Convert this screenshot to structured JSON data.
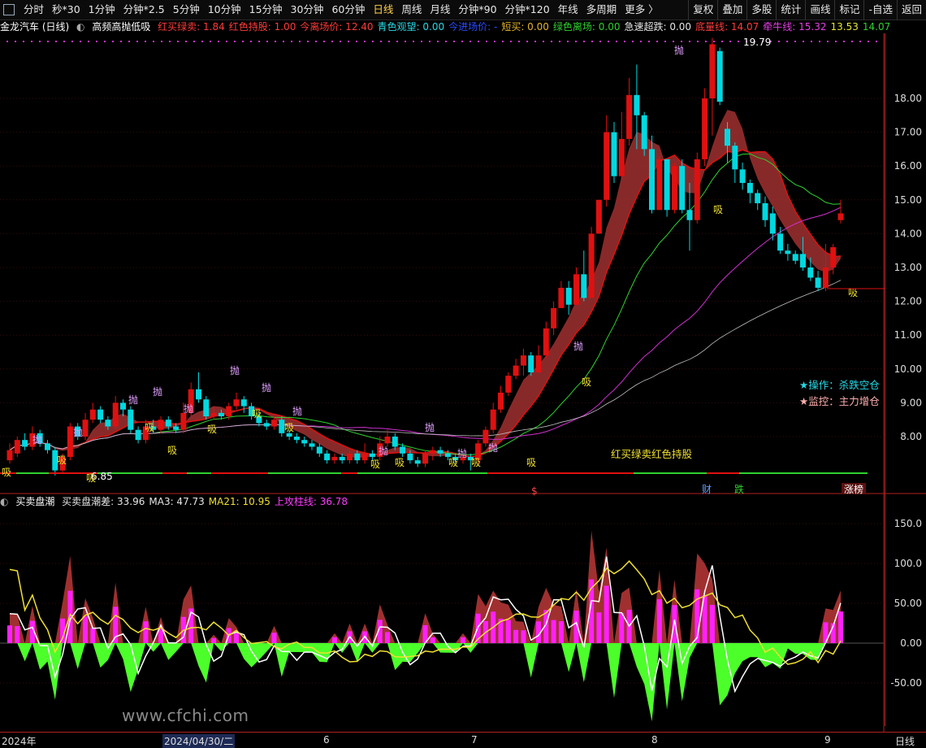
{
  "toolbar": {
    "periods": [
      "分时",
      "秒*30",
      "1分钟",
      "分钟*2.5",
      "5分钟",
      "10分钟",
      "15分钟",
      "30分钟",
      "60分钟",
      "日线",
      "周线",
      "月线",
      "分钟*90",
      "分钟*120",
      "年线",
      "多周期",
      "更多 〉"
    ],
    "active_period": "日线",
    "right_buttons": [
      "复权",
      "叠加",
      "多股",
      "统计",
      "画线",
      "标记",
      "-自选",
      "返回"
    ]
  },
  "stock": {
    "name": "金龙汽车 (日线)"
  },
  "main_indicator": {
    "name": "高频高抛低吸",
    "fields": [
      {
        "label": "红买绿卖:",
        "value": "1.84",
        "color": "#ff3b3b"
      },
      {
        "label": "红色持股:",
        "value": "1.00",
        "color": "#ff3b3b"
      },
      {
        "label": "今离场价:",
        "value": "12.40",
        "color": "#ff3b3b"
      },
      {
        "label": "青色观望:",
        "value": "0.00",
        "color": "#26d9e6"
      },
      {
        "label": "今进场价:",
        "value": "-",
        "color": "#2a4cff"
      },
      {
        "label": "短买:",
        "value": "0.00",
        "color": "#e5b62a"
      },
      {
        "label": "绿色离场:",
        "value": "0.00",
        "color": "#2ed12e"
      },
      {
        "label": "急速超跌:",
        "value": "0.00",
        "color": "#e6e6e6"
      },
      {
        "label": "底量线:",
        "value": "14.07",
        "color": "#ff3b3b"
      },
      {
        "label": "牵牛线:",
        "value": "15.32",
        "color": "#e63ee6"
      },
      {
        "label": "",
        "value": "13.53",
        "color": "#e6e62a"
      },
      {
        "label": "",
        "value": "14.07",
        "color": "#2ed12e"
      }
    ]
  },
  "sub_indicator": {
    "name": "买卖盘潮",
    "fields": [
      {
        "label": "买卖盘潮差:",
        "value": "33.96",
        "color": "#e6e6e6"
      },
      {
        "label": "MA3:",
        "value": "47.73",
        "color": "#e6e6e6"
      },
      {
        "label": "MA21:",
        "value": "10.95",
        "color": "#f0e030"
      },
      {
        "label": "上攻柱线:",
        "value": "36.78",
        "color": "#ff3bff"
      }
    ]
  },
  "price_axis": [
    "18.00",
    "17.00",
    "16.00",
    "15.00",
    "14.00",
    "13.00",
    "12.00",
    "11.00",
    "10.00",
    "9.00",
    "8.00"
  ],
  "sub_axis": [
    "150.0",
    "100.0",
    "50.00",
    "0.00",
    "-50.00"
  ],
  "date_axis": [
    "2024年",
    "2024/04/30/二",
    "6",
    "7",
    "8",
    "9",
    "日线"
  ],
  "annotations": {
    "high_label": "19.79",
    "low_label": "6.85",
    "op_label": "★操作：杀跌空仓",
    "monitor_label": "★监控：主力增仓",
    "legend_text": "红买绿卖红色持股",
    "sell_mark": "抛",
    "buy_mark": "吸",
    "events": [
      "$",
      "财",
      "跌",
      "涨榜"
    ]
  },
  "colors": {
    "up": "#e01010",
    "down": "#00d8e0",
    "ma_white": "#ffffff",
    "ma_yellow": "#f0e030",
    "ma_green": "#2ed12e",
    "ma_magenta": "#d030d0",
    "ribbon_red": "#a03030",
    "ribbon_green": "#78a040"
  },
  "watermark": "www.cfchi.com",
  "chart_data": {
    "type": "candlestick",
    "title": "金龙汽车 (日线)",
    "ylim": [
      7.0,
      19.8
    ],
    "candles": [
      [
        7.3,
        7.6,
        7.8,
        7.2
      ],
      [
        7.5,
        7.9,
        8.0,
        7.4
      ],
      [
        7.9,
        7.7,
        8.1,
        7.6
      ],
      [
        7.7,
        8.1,
        8.3,
        7.6
      ],
      [
        8.1,
        7.8,
        8.2,
        7.7
      ],
      [
        7.8,
        7.6,
        7.9,
        7.5
      ],
      [
        7.6,
        7.0,
        7.7,
        6.85
      ],
      [
        7.0,
        7.4,
        7.5,
        6.9
      ],
      [
        7.4,
        8.3,
        8.4,
        7.3
      ],
      [
        8.3,
        8.0,
        8.4,
        7.9
      ],
      [
        8.0,
        8.5,
        8.7,
        7.9
      ],
      [
        8.5,
        8.8,
        9.0,
        8.4
      ],
      [
        8.8,
        8.5,
        8.9,
        8.4
      ],
      [
        8.5,
        8.3,
        8.6,
        8.2
      ],
      [
        8.3,
        9.0,
        9.2,
        8.2
      ],
      [
        9.0,
        8.8,
        9.1,
        8.6
      ],
      [
        8.8,
        8.2,
        8.9,
        8.1
      ],
      [
        8.2,
        7.9,
        8.3,
        7.8
      ],
      [
        7.9,
        8.3,
        8.5,
        7.8
      ],
      [
        8.3,
        8.2,
        8.5,
        8.1
      ],
      [
        8.2,
        8.5,
        8.6,
        8.1
      ],
      [
        8.5,
        8.3,
        8.6,
        8.2
      ],
      [
        8.3,
        8.2,
        8.4,
        8.1
      ],
      [
        8.2,
        8.7,
        9.0,
        8.1
      ],
      [
        8.7,
        9.4,
        9.6,
        8.6
      ],
      [
        9.4,
        9.1,
        9.9,
        9.0
      ],
      [
        9.1,
        8.6,
        9.2,
        8.5
      ],
      [
        8.6,
        8.7,
        8.9,
        8.5
      ],
      [
        8.7,
        8.6,
        8.8,
        8.5
      ],
      [
        8.6,
        8.9,
        9.0,
        8.5
      ],
      [
        8.9,
        9.1,
        9.3,
        8.8
      ],
      [
        9.1,
        8.9,
        9.2,
        8.7
      ],
      [
        8.9,
        8.6,
        9.0,
        8.5
      ],
      [
        8.6,
        8.4,
        8.7,
        8.3
      ],
      [
        8.4,
        8.3,
        8.5,
        8.2
      ],
      [
        8.3,
        8.5,
        8.6,
        8.2
      ],
      [
        8.5,
        8.1,
        8.6,
        8.0
      ],
      [
        8.1,
        8.0,
        8.2,
        7.9
      ],
      [
        8.0,
        7.9,
        8.1,
        7.8
      ],
      [
        7.9,
        7.8,
        8.0,
        7.7
      ],
      [
        7.8,
        7.7,
        7.9,
        7.6
      ],
      [
        7.7,
        7.5,
        7.8,
        7.4
      ],
      [
        7.5,
        7.3,
        7.6,
        7.2
      ],
      [
        7.3,
        7.4,
        7.5,
        7.2
      ],
      [
        7.4,
        7.3,
        7.5,
        7.2
      ],
      [
        7.3,
        7.5,
        7.6,
        7.2
      ],
      [
        7.5,
        7.3,
        7.6,
        7.2
      ],
      [
        7.3,
        7.5,
        7.8,
        7.2
      ],
      [
        7.5,
        7.4,
        7.6,
        7.3
      ],
      [
        7.4,
        7.8,
        8.0,
        7.3
      ],
      [
        7.8,
        8.0,
        8.2,
        7.7
      ],
      [
        8.0,
        7.7,
        8.1,
        7.6
      ],
      [
        7.7,
        7.5,
        7.8,
        7.4
      ],
      [
        7.5,
        7.3,
        7.6,
        7.2
      ],
      [
        7.3,
        7.2,
        7.4,
        7.1
      ],
      [
        7.2,
        7.5,
        7.6,
        7.1
      ],
      [
        7.5,
        7.6,
        7.7,
        7.3
      ],
      [
        7.6,
        7.5,
        7.7,
        7.4
      ],
      [
        7.5,
        7.4,
        7.6,
        7.3
      ],
      [
        7.4,
        7.3,
        7.5,
        7.2
      ],
      [
        7.3,
        7.4,
        7.5,
        7.2
      ],
      [
        7.4,
        7.3,
        7.5,
        7.0
      ],
      [
        7.3,
        7.8,
        7.9,
        7.2
      ],
      [
        7.8,
        8.2,
        8.3,
        7.7
      ],
      [
        8.2,
        8.8,
        9.0,
        8.1
      ],
      [
        8.8,
        9.3,
        9.5,
        8.7
      ],
      [
        9.3,
        9.8,
        9.9,
        9.2
      ],
      [
        9.8,
        10.1,
        10.3,
        9.7
      ],
      [
        10.1,
        10.4,
        10.6,
        9.8
      ],
      [
        10.4,
        9.9,
        10.5,
        9.8
      ],
      [
        9.9,
        10.4,
        10.7,
        9.9
      ],
      [
        10.4,
        11.2,
        11.4,
        10.3
      ],
      [
        11.2,
        11.8,
        12.0,
        11.0
      ],
      [
        11.8,
        12.4,
        12.6,
        11.8
      ],
      [
        12.4,
        11.9,
        12.6,
        11.6
      ],
      [
        11.9,
        12.8,
        13.0,
        11.9
      ],
      [
        12.8,
        12.1,
        13.5,
        12.0
      ],
      [
        12.1,
        14.0,
        14.2,
        12.1
      ],
      [
        14.0,
        15.0,
        15.0,
        14.0
      ],
      [
        15.0,
        17.0,
        17.5,
        14.8
      ],
      [
        17.0,
        15.7,
        17.3,
        15.5
      ],
      [
        15.7,
        16.8,
        17.6,
        15.6
      ],
      [
        16.8,
        18.1,
        18.6,
        16.6
      ],
      [
        18.1,
        17.5,
        19.0,
        16.5
      ],
      [
        17.5,
        16.5,
        17.6,
        16.3
      ],
      [
        16.5,
        14.7,
        16.9,
        14.6
      ],
      [
        14.7,
        16.2,
        16.3,
        14.7
      ],
      [
        16.2,
        14.7,
        16.2,
        14.5
      ],
      [
        14.7,
        16.0,
        16.1,
        14.6
      ],
      [
        16.0,
        14.7,
        16.2,
        14.6
      ],
      [
        14.7,
        14.4,
        15.5,
        13.5
      ],
      [
        14.4,
        16.2,
        16.4,
        14.3
      ],
      [
        16.2,
        18.0,
        18.3,
        16.0
      ],
      [
        18.0,
        19.6,
        19.79,
        16.9
      ],
      [
        19.4,
        17.9,
        19.5,
        17.8
      ],
      [
        17.1,
        16.6,
        17.3,
        16.1
      ],
      [
        16.6,
        15.9,
        16.7,
        15.5
      ],
      [
        15.9,
        15.5,
        16.1,
        15.3
      ],
      [
        15.5,
        15.2,
        15.6,
        14.9
      ],
      [
        15.2,
        14.9,
        15.3,
        14.7
      ],
      [
        14.9,
        14.4,
        15.1,
        14.2
      ],
      [
        14.6,
        14.0,
        14.8,
        13.8
      ],
      [
        14.0,
        13.5,
        14.2,
        13.4
      ],
      [
        13.5,
        13.4,
        13.7,
        13.2
      ],
      [
        13.4,
        13.2,
        13.5,
        13.1
      ],
      [
        13.4,
        13.0,
        13.9,
        12.9
      ],
      [
        13.0,
        12.7,
        13.3,
        12.6
      ],
      [
        12.7,
        12.4,
        12.9,
        12.3
      ],
      [
        12.4,
        13.0,
        13.7,
        12.3
      ],
      [
        13.0,
        13.6,
        13.7,
        12.8
      ],
      [
        14.4,
        14.6,
        15.0,
        14.3
      ]
    ]
  }
}
